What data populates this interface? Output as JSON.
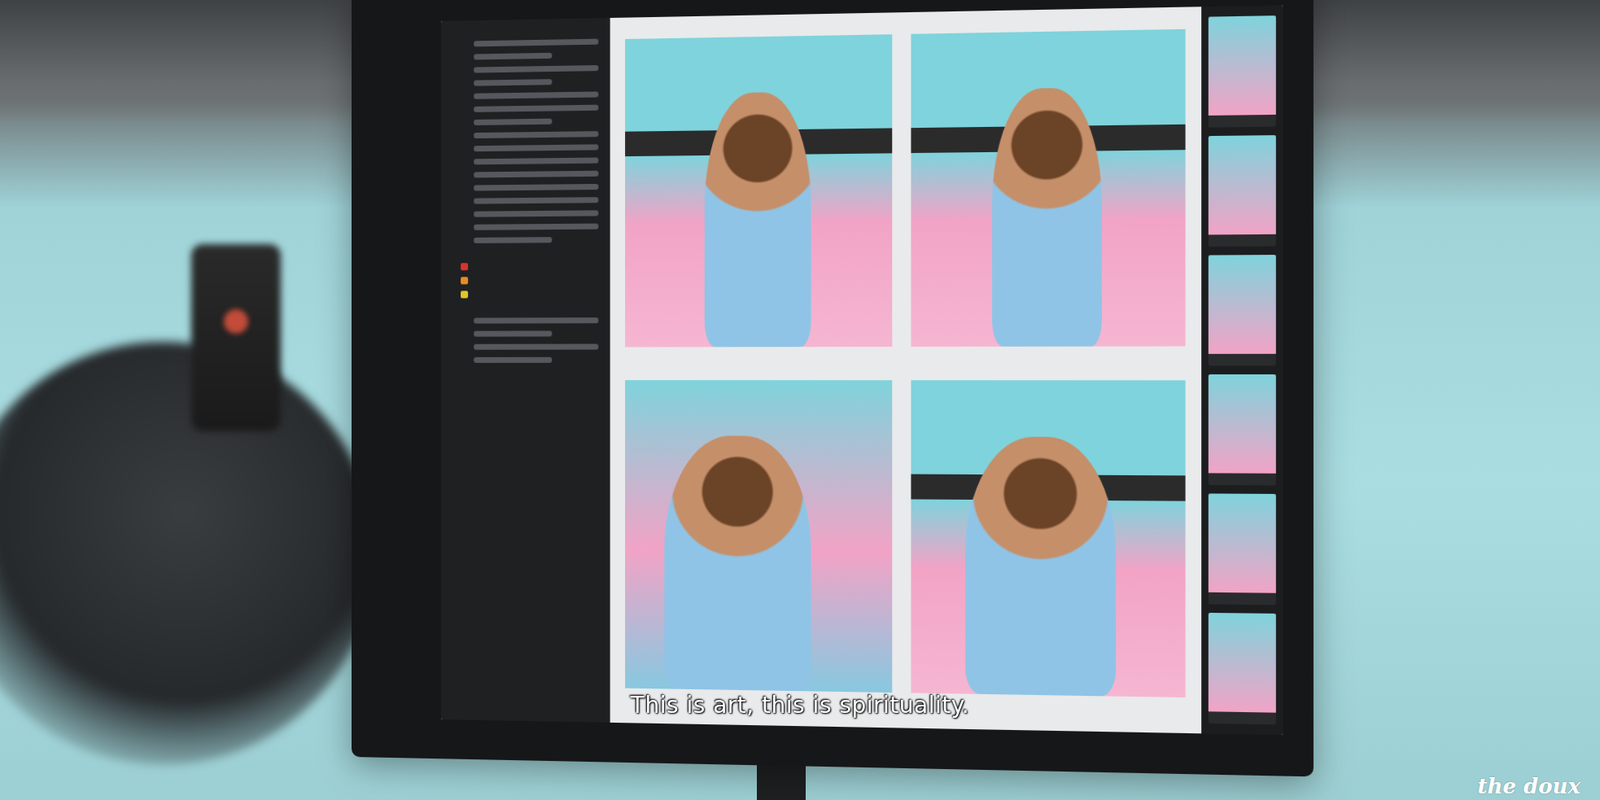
{
  "subtitle": "This is art, this is spirituality.",
  "watermark": {
    "text": "the doux"
  }
}
